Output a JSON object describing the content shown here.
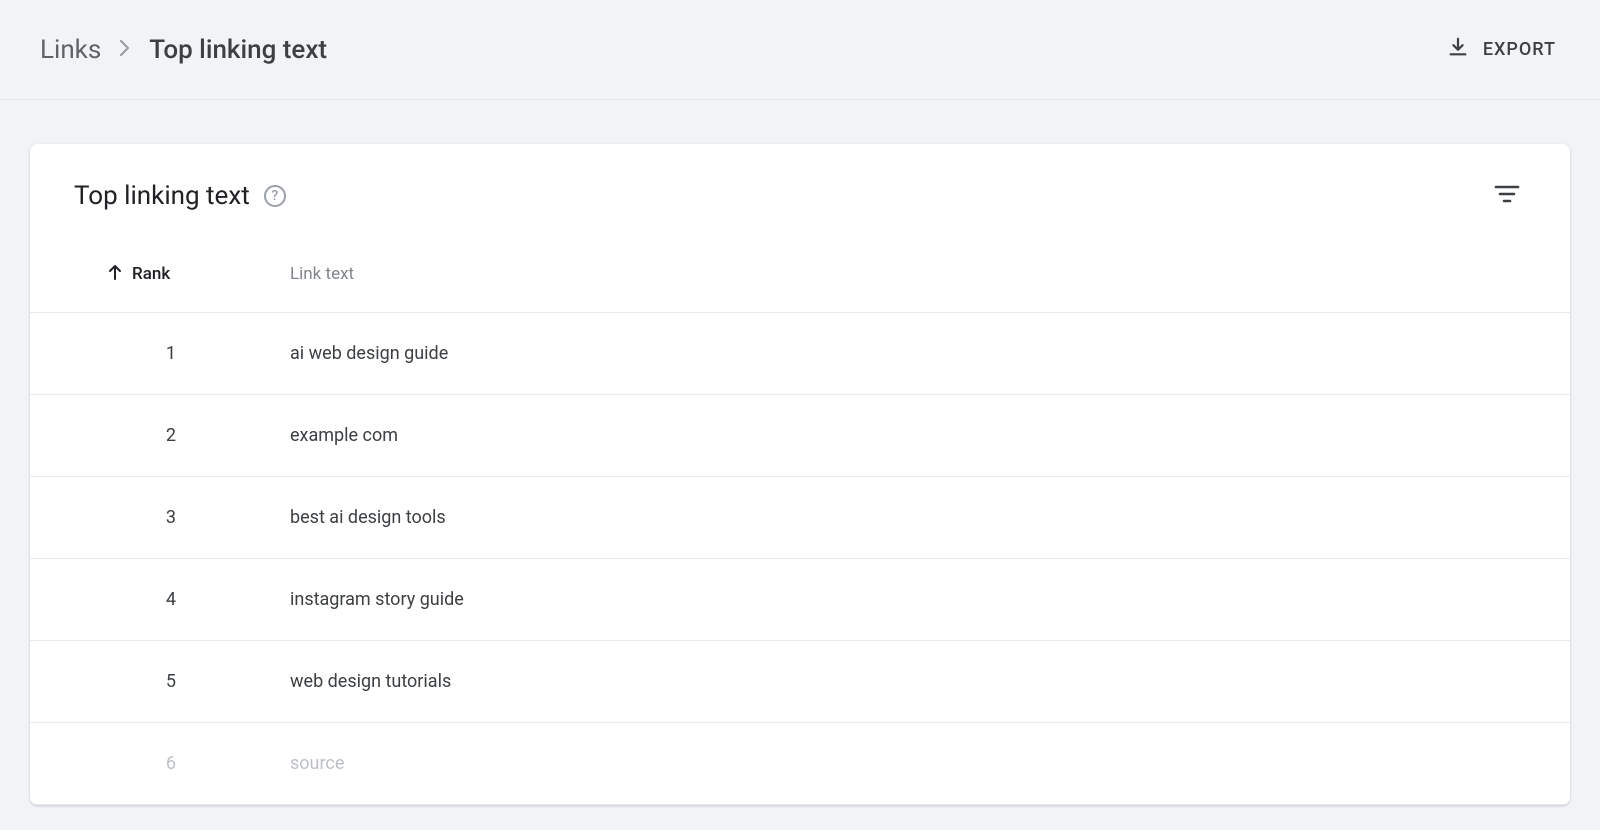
{
  "breadcrumb": {
    "parent": "Links",
    "current": "Top linking text"
  },
  "export_label": "EXPORT",
  "card": {
    "title": "Top linking text"
  },
  "columns": {
    "rank": "Rank",
    "link_text": "Link text"
  },
  "rows": [
    {
      "rank": "1",
      "text": "ai web design guide"
    },
    {
      "rank": "2",
      "text": "example com"
    },
    {
      "rank": "3",
      "text": "best ai design tools"
    },
    {
      "rank": "4",
      "text": "instagram story guide"
    },
    {
      "rank": "5",
      "text": "web design tutorials"
    },
    {
      "rank": "6",
      "text": "source"
    }
  ]
}
